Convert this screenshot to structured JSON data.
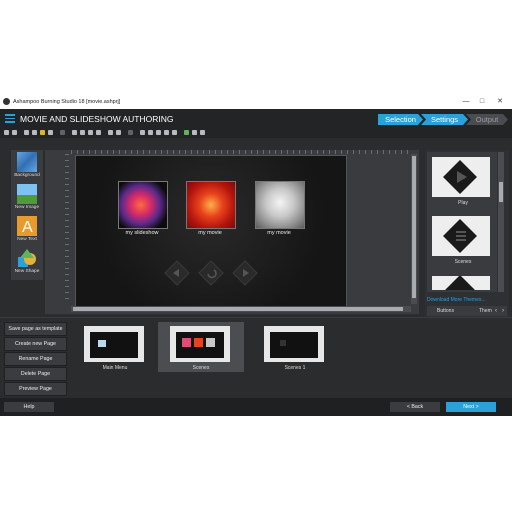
{
  "window": {
    "title": "Ashampoo Burning Studio 18 [movie.ashprj]",
    "controls": [
      "—",
      "□",
      "✕"
    ]
  },
  "header": {
    "title": "MOVIE AND SLIDESHOW AUTHORING",
    "steps": [
      "Selection",
      "Settings",
      "Output"
    ]
  },
  "palette": [
    {
      "label": "Background",
      "icon": "background-icon"
    },
    {
      "label": "New Image",
      "icon": "new-image-icon"
    },
    {
      "label": "New Text",
      "icon": "new-text-icon"
    },
    {
      "label": "New Shape",
      "icon": "new-shape-icon"
    }
  ],
  "canvas": {
    "items": [
      {
        "label": "my slideshow"
      },
      {
        "label": "my movie"
      },
      {
        "label": "my movie"
      }
    ]
  },
  "themes": {
    "items": [
      {
        "label": "Play"
      },
      {
        "label": "Scenes"
      }
    ],
    "download_link": "Download More Themes...",
    "tabs": [
      "Buttons",
      "Them"
    ]
  },
  "page_actions": [
    "Save page as template",
    "Create new Page",
    "Rename Page",
    "Delete Page",
    "Preview Page"
  ],
  "pages": [
    {
      "label": "Main Menu"
    },
    {
      "label": "Scenes"
    },
    {
      "label": "Scenes 1"
    }
  ],
  "footer": {
    "help": "Help",
    "back": "< Back",
    "next": "Next >"
  },
  "colors": {
    "accent": "#2aa1d9",
    "bg": "#2b2c2e"
  }
}
